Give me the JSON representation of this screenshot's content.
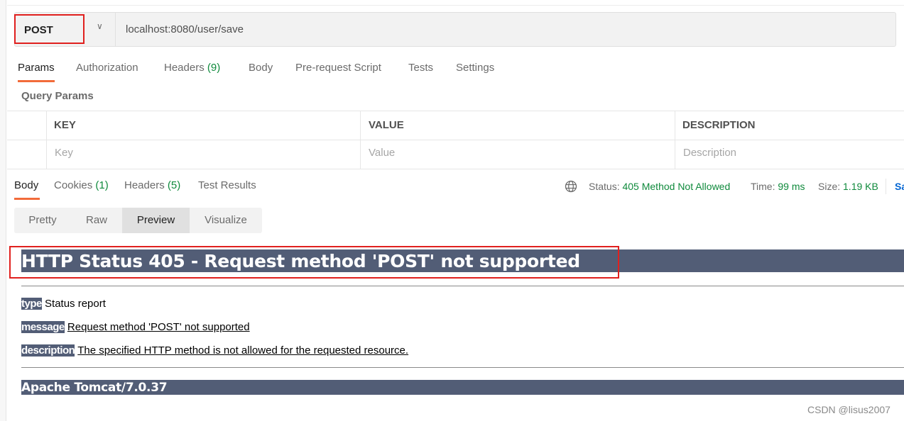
{
  "request": {
    "method": "POST",
    "url": "localhost:8080/user/save"
  },
  "request_tabs": [
    {
      "label": "Params"
    },
    {
      "label": "Authorization"
    },
    {
      "label": "Headers",
      "count": "(9)"
    },
    {
      "label": "Body"
    },
    {
      "label": "Pre-request Script"
    },
    {
      "label": "Tests"
    },
    {
      "label": "Settings"
    }
  ],
  "params": {
    "title": "Query Params",
    "columns": [
      "KEY",
      "VALUE",
      "DESCRIPTION"
    ],
    "placeholders": [
      "Key",
      "Value",
      "Description"
    ]
  },
  "response_tabs": [
    {
      "label": "Body"
    },
    {
      "label": "Cookies",
      "count": "(1)"
    },
    {
      "label": "Headers",
      "count": "(5)"
    },
    {
      "label": "Test Results"
    }
  ],
  "status": {
    "status_label": "Status:",
    "status_value": "405 Method Not Allowed",
    "time_label": "Time:",
    "time_value": "99 ms",
    "size_label": "Size:",
    "size_value": "1.19 KB",
    "save_label": "Sa"
  },
  "view_modes": [
    "Pretty",
    "Raw",
    "Preview",
    "Visualize"
  ],
  "active_view": "Preview",
  "preview": {
    "title": "HTTP Status 405 - Request method 'POST' not supported",
    "type_label": "type",
    "type_value": "Status report",
    "message_label": "message",
    "message_value": "Request method 'POST' not supported",
    "description_label": "description",
    "description_value": "The specified HTTP method is not allowed for the requested resource.",
    "server": "Apache Tomcat/7.0.37"
  },
  "watermark": "CSDN @lisus2007",
  "colors": {
    "accent": "#f26b3a",
    "success": "#0f8a3c",
    "highlight": "#e0201e",
    "tomcat_bar": "#525d76"
  }
}
